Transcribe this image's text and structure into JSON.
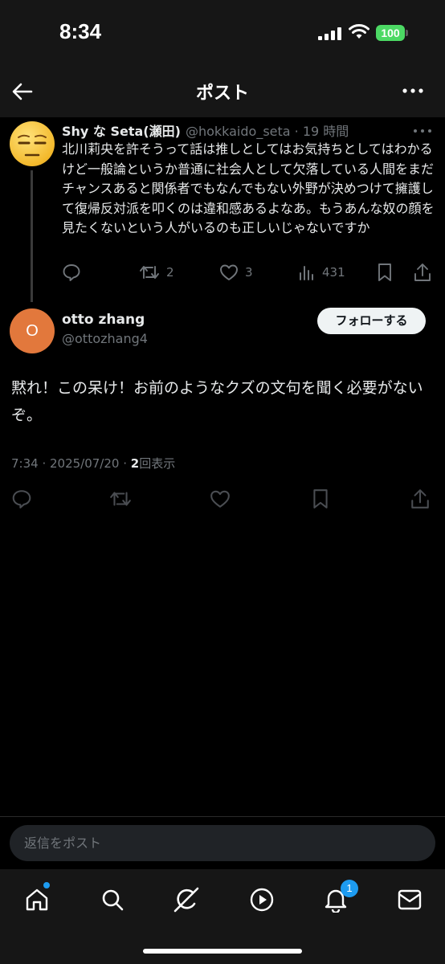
{
  "status_bar": {
    "time": "8:34",
    "battery": "100"
  },
  "header": {
    "title": "ポスト"
  },
  "parent_tweet": {
    "author_name": "Shy な Seta(瀬田)",
    "author_meta": "@hokkaido_seta · 19 時間",
    "text": "北川莉央を許そうって話は推しとしてはお気持ちとしてはわかるけど一般論というか普通に社会人として欠落している人間をまだチャンスあると関係者でもなんでもない外野が決めつけて擁護して復帰反対派を叩くのは違和感あるよなあ。もうあんな奴の顔を見たくないという人がいるのも正しいじゃないですか",
    "retweets": "2",
    "likes": "3",
    "views": "431"
  },
  "reply": {
    "avatar_letter": "O",
    "author_name": "otto zhang",
    "handle": "@ottozhang4",
    "follow_label": "フォローする",
    "text": "黙れ！この呆け！お前のようなクズの文句を聞く必要がないぞ。",
    "timestamp": "7:34 · 2025/07/20 · ",
    "views_count": "2",
    "views_label": "回表示"
  },
  "composer": {
    "placeholder": "返信をポスト"
  },
  "tabbar": {
    "notification_count": "1"
  },
  "colors": {
    "background": "#000000",
    "accent": "#1d9bf0",
    "muted": "#71767b",
    "avatar_orange": "#e2783c"
  },
  "icons": [
    "back-arrow-icon",
    "more-icon",
    "reply-icon",
    "retweet-icon",
    "like-icon",
    "views-icon",
    "bookmark-icon",
    "share-icon",
    "home-icon",
    "search-icon",
    "grok-icon",
    "video-icon",
    "notifications-icon",
    "messages-icon"
  ]
}
